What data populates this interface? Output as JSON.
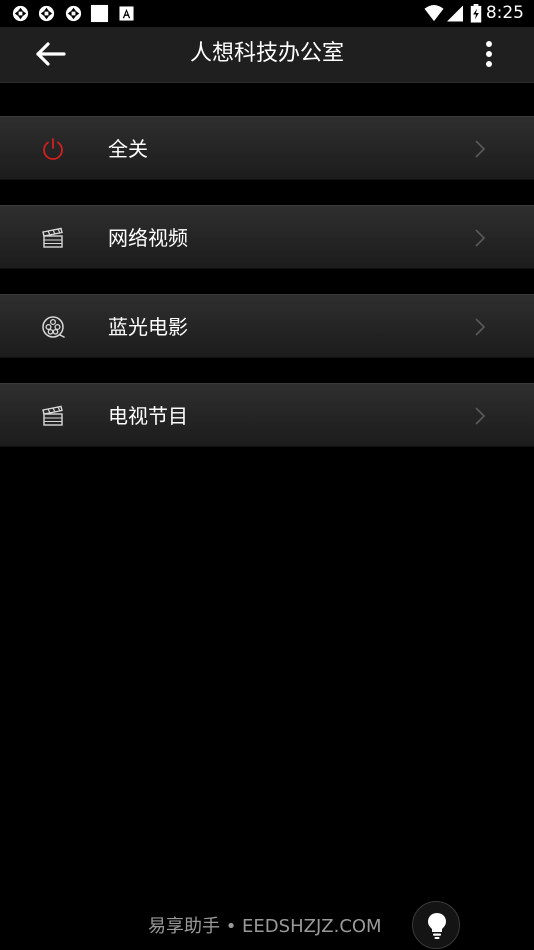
{
  "status_bar": {
    "time": "8:25",
    "icons": [
      "sync-icon",
      "sync-icon",
      "sync-icon",
      "blank-square-icon",
      "font-a-icon",
      "wifi-icon",
      "signal-icon",
      "battery-charging-icon"
    ]
  },
  "app_bar": {
    "title": "人想科技办公室",
    "back_icon": "arrow-left-icon",
    "more_icon": "more-vert-icon"
  },
  "menu": {
    "items": [
      {
        "label": "全关",
        "icon": "power-icon",
        "icon_color": "#d11f1f"
      },
      {
        "label": "网络视频",
        "icon": "clapperboard-icon",
        "icon_color": "#d8d8d8"
      },
      {
        "label": "蓝光电影",
        "icon": "film-reel-icon",
        "icon_color": "#d8d8d8"
      },
      {
        "label": "电视节目",
        "icon": "clapperboard-icon",
        "icon_color": "#d8d8d8"
      }
    ]
  },
  "watermark": {
    "text": "易享助手 • EEDSHZJZ.COM",
    "icon": "lightbulb-icon"
  },
  "colors": {
    "background": "#000000",
    "app_bar": "#1f1f1f",
    "row": "#262626",
    "accent_power": "#d11f1f",
    "chevron": "#5a5a5a"
  }
}
